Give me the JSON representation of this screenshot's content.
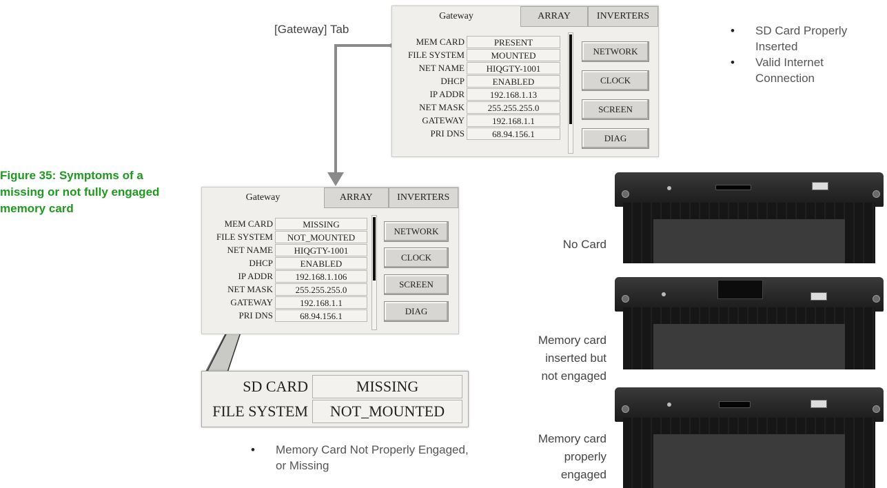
{
  "figure_caption": "Figure 35: Symptoms of a missing or not fully engaged memory card",
  "gateway_tab_callout": "[Gateway] Tab",
  "panels": {
    "good": {
      "tabs": [
        "Gateway",
        "ARRAY",
        "INVERTERS"
      ],
      "rows": [
        {
          "label": "MEM CARD",
          "value": "PRESENT"
        },
        {
          "label": "FILE SYSTEM",
          "value": "MOUNTED"
        },
        {
          "label": "NET NAME",
          "value": "HIQGTY-1001"
        },
        {
          "label": "DHCP",
          "value": "ENABLED"
        },
        {
          "label": "IP ADDR",
          "value": "192.168.1.13"
        },
        {
          "label": "NET MASK",
          "value": "255.255.255.0"
        },
        {
          "label": "GATEWAY",
          "value": "192.168.1.1"
        },
        {
          "label": "PRI DNS",
          "value": "68.94.156.1"
        }
      ],
      "buttons": [
        "NETWORK",
        "CLOCK",
        "SCREEN",
        "DIAG"
      ]
    },
    "bad": {
      "tabs": [
        "Gateway",
        "ARRAY",
        "INVERTERS"
      ],
      "rows": [
        {
          "label": "MEM CARD",
          "value": "MISSING"
        },
        {
          "label": "FILE SYSTEM",
          "value": "NOT_MOUNTED"
        },
        {
          "label": "NET NAME",
          "value": "HIQGTY-1001"
        },
        {
          "label": "DHCP",
          "value": "ENABLED"
        },
        {
          "label": "IP ADDR",
          "value": "192.168.1.106"
        },
        {
          "label": "NET MASK",
          "value": "255.255.255.0"
        },
        {
          "label": "GATEWAY",
          "value": "192.168.1.1"
        },
        {
          "label": "PRI DNS",
          "value": "68.94.156.1"
        }
      ],
      "buttons": [
        "NETWORK",
        "CLOCK",
        "SCREEN",
        "DIAG"
      ]
    }
  },
  "zoom": {
    "rows": [
      {
        "label": "SD CARD",
        "value": "MISSING"
      },
      {
        "label": "FILE SYSTEM",
        "value": "NOT_MOUNTED"
      }
    ]
  },
  "good_bullets": [
    "SD Card Properly Inserted",
    "Valid Internet Connection"
  ],
  "bad_bullets": [
    "Memory Card Not Properly Engaged, or Missing"
  ],
  "devices": [
    {
      "label": [
        "No Card"
      ]
    },
    {
      "label": [
        "Memory card",
        "inserted but",
        "not engaged"
      ]
    },
    {
      "label": [
        "Memory card",
        "properly",
        "engaged"
      ]
    }
  ],
  "bullet_char": "•",
  "colors": {
    "caption": "#1e9a1e",
    "arrow": "#8a8a8a"
  }
}
